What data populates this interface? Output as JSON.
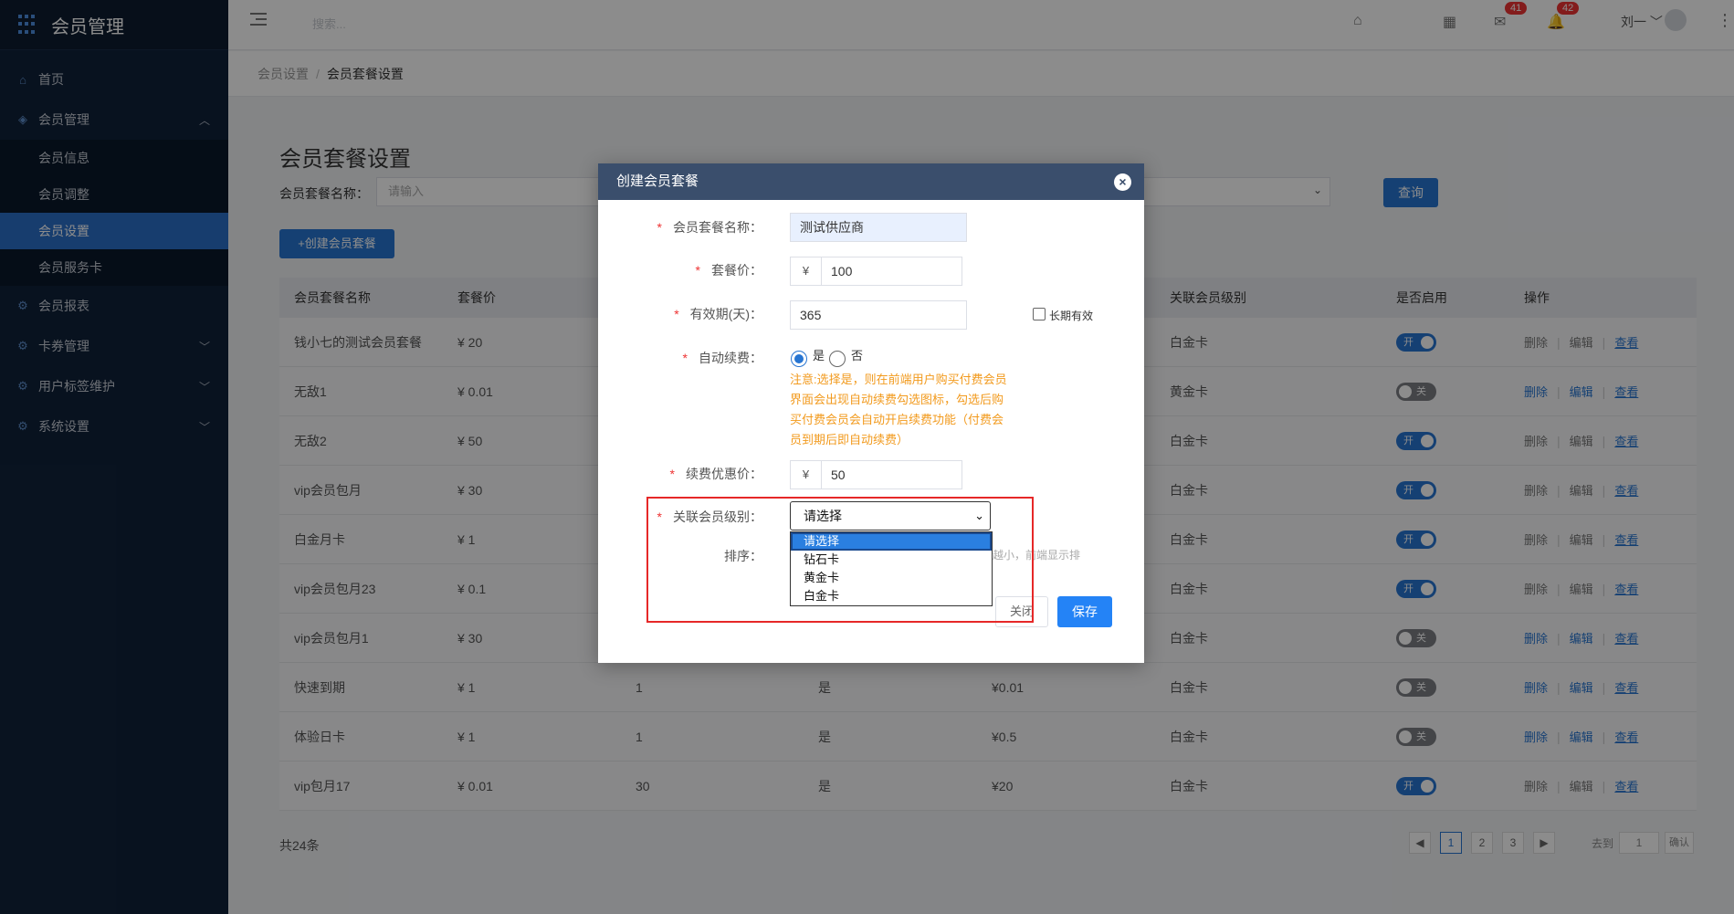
{
  "app": {
    "title": "会员管理"
  },
  "sidebar": {
    "items": [
      {
        "label": "首页",
        "icon": "home-icon"
      },
      {
        "label": "会员管理",
        "icon": "diamond-icon",
        "expanded": true,
        "children": [
          {
            "label": "会员信息"
          },
          {
            "label": "会员调整"
          },
          {
            "label": "会员设置",
            "active": true
          },
          {
            "label": "会员服务卡"
          }
        ]
      },
      {
        "label": "会员报表",
        "icon": "gear-icon"
      },
      {
        "label": "卡券管理",
        "icon": "gear-icon"
      },
      {
        "label": "用户标签维护",
        "icon": "gear-icon"
      },
      {
        "label": "系统设置",
        "icon": "gear-icon"
      }
    ]
  },
  "topbar": {
    "search_placeholder": "搜索...",
    "mail_badge": "41",
    "bell_badge": "42",
    "user_name": "刘一"
  },
  "breadcrumb": {
    "parent": "会员设置",
    "current": "会员套餐设置"
  },
  "page": {
    "title": "会员套餐设置",
    "filter_label": "会员套餐名称：",
    "filter_placeholder": "请输入",
    "query_label": "查询",
    "create_label": "+创建会员套餐"
  },
  "table": {
    "headers": [
      "会员套餐名称",
      "套餐价",
      "",
      "",
      "",
      "关联会员级别",
      "是否启用",
      "操作"
    ],
    "rows": [
      {
        "name": "钱小七的测试会员套餐",
        "price": "¥ 20",
        "days": "",
        "auto": "",
        "renew": "",
        "level": "白金卡",
        "enabled": true
      },
      {
        "name": "无敌1",
        "price": "¥ 0.01",
        "days": "",
        "auto": "",
        "renew": "",
        "level": "黄金卡",
        "enabled": false
      },
      {
        "name": "无敌2",
        "price": "¥ 50",
        "days": "",
        "auto": "",
        "renew": "",
        "level": "白金卡",
        "enabled": true
      },
      {
        "name": "vip会员包月",
        "price": "¥ 30",
        "days": "",
        "auto": "",
        "renew": "",
        "level": "白金卡",
        "enabled": true
      },
      {
        "name": "白金月卡",
        "price": "¥ 1",
        "days": "",
        "auto": "",
        "renew": "",
        "level": "白金卡",
        "enabled": true
      },
      {
        "name": "vip会员包月23",
        "price": "¥ 0.1",
        "days": "",
        "auto": "",
        "renew": "",
        "level": "白金卡",
        "enabled": true
      },
      {
        "name": "vip会员包月1",
        "price": "¥ 30",
        "days": "",
        "auto": "",
        "renew": "",
        "level": "白金卡",
        "enabled": false
      },
      {
        "name": "快速到期",
        "price": "¥ 1",
        "days": "1",
        "auto": "是",
        "renew": "¥0.01",
        "level": "白金卡",
        "enabled": false
      },
      {
        "name": "体验日卡",
        "price": "¥ 1",
        "days": "1",
        "auto": "是",
        "renew": "¥0.5",
        "level": "白金卡",
        "enabled": false
      },
      {
        "name": "vip包月17",
        "price": "¥ 0.01",
        "days": "30",
        "auto": "是",
        "renew": "¥20",
        "level": "白金卡",
        "enabled": true
      }
    ],
    "toggle_on": "开",
    "toggle_off": "关",
    "op_delete": "删除",
    "op_edit": "编辑",
    "op_view": "查看"
  },
  "pagination": {
    "total": "共24条",
    "pages": [
      "1",
      "2",
      "3"
    ],
    "current": "1",
    "goto_label": "去到",
    "goto_value": "1",
    "ok_label": "确认"
  },
  "modal": {
    "title": "创建会员套餐",
    "fields": {
      "name_label": "会员套餐名称：",
      "name_value": "测试供应商",
      "price_label": "套餐价：",
      "currency": "¥",
      "price_value": "100",
      "validity_label": "有效期(天)：",
      "validity_value": "365",
      "long_term_label": "长期有效",
      "auto_renew_label": "自动续费：",
      "yes_label": "是",
      "no_label": "否",
      "note": "注意:选择是，则在前端用户购买付费会员界面会出现自动续费勾选图标，勾选后购买付费会员会自动开启续费功能（付费会员到期后即自动续费）",
      "renew_price_label": "续费优惠价：",
      "renew_price_value": "50",
      "level_label": "关联会员级别：",
      "level_selected": "请选择",
      "level_options": [
        "请选择",
        "钻石卡",
        "黄金卡",
        "白金卡"
      ],
      "sort_label": "排序：",
      "sort_hint": "越小，前端显示排"
    },
    "close_label": "关闭",
    "save_label": "保存"
  },
  "colors": {
    "sidebar_bg": "#10223a",
    "accent": "#2775d2",
    "note": "#f29a1d",
    "highlight": "#e62828"
  }
}
